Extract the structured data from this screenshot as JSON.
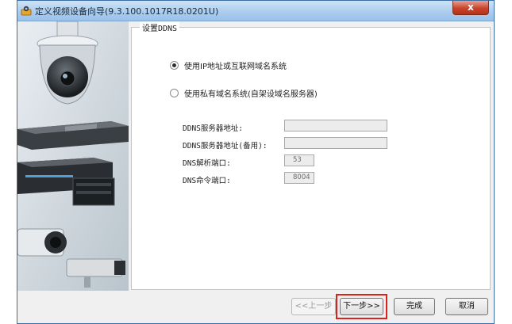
{
  "window": {
    "title": "定义视频设备向导(9.3.100.1017R18.0201U)",
    "close_label": "x"
  },
  "group": {
    "legend": "设置DDNS"
  },
  "options": {
    "use_ip": "使用IP地址或互联网域名系统",
    "use_private": "使用私有域名系统(自架设域名服务器)",
    "selected": "use_ip"
  },
  "fields": [
    {
      "label": "DDNS服务器地址:",
      "value": ""
    },
    {
      "label": "DDNS服务器地址(备用):",
      "value": ""
    },
    {
      "label": "DNS解析端口:",
      "value": "53"
    },
    {
      "label": "DNS命令端口:",
      "value": "8004"
    }
  ],
  "buttons": {
    "prev": "<<上一步",
    "next": "下一步>>",
    "finish": "完成",
    "cancel": "取消"
  },
  "colors": {
    "accent_highlight": "#e0201b",
    "titlebar": "#a9cbed",
    "close": "#c9442c"
  }
}
